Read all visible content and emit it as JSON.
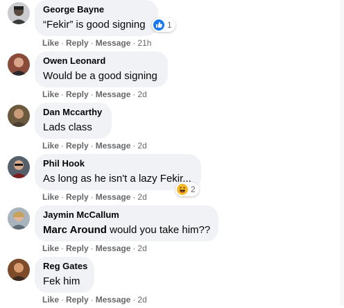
{
  "comments": [
    {
      "author": "George Bayne",
      "text": "“Fekir” is good signing",
      "reaction": {
        "icon": "like-icon",
        "count": "1"
      },
      "actions": {
        "like": "Like",
        "reply": "Reply",
        "message": "Message",
        "time": "21h"
      }
    },
    {
      "author": "Owen Leonard",
      "text": "Would be a good signing",
      "actions": {
        "like": "Like",
        "reply": "Reply",
        "message": "Message",
        "time": "2d"
      }
    },
    {
      "author": "Dan Mccarthy",
      "text": "Lads class",
      "actions": {
        "like": "Like",
        "reply": "Reply",
        "message": "Message",
        "time": "2d"
      }
    },
    {
      "author": "Phil Hook",
      "text": "As long as he isn't a lazy Fekir...",
      "reaction": {
        "icon": "haha-icon",
        "count": "2"
      },
      "actions": {
        "like": "Like",
        "reply": "Reply",
        "message": "Message",
        "time": "2d"
      }
    },
    {
      "author": "Jaymin McCallum",
      "mention": "Marc Around",
      "text": " would you take him??",
      "actions": {
        "like": "Like",
        "reply": "Reply",
        "message": "Message",
        "time": "2d"
      }
    },
    {
      "author": "Reg Gates",
      "text": "Fek him",
      "actions": {
        "like": "Like",
        "reply": "Reply",
        "message": "Message",
        "time": "2d"
      }
    }
  ],
  "colors": {
    "bubble": "#f0f2f5",
    "like_blue": "#1877f2",
    "haha_yellow": "#f7b928",
    "meta_gray": "#65676b"
  }
}
